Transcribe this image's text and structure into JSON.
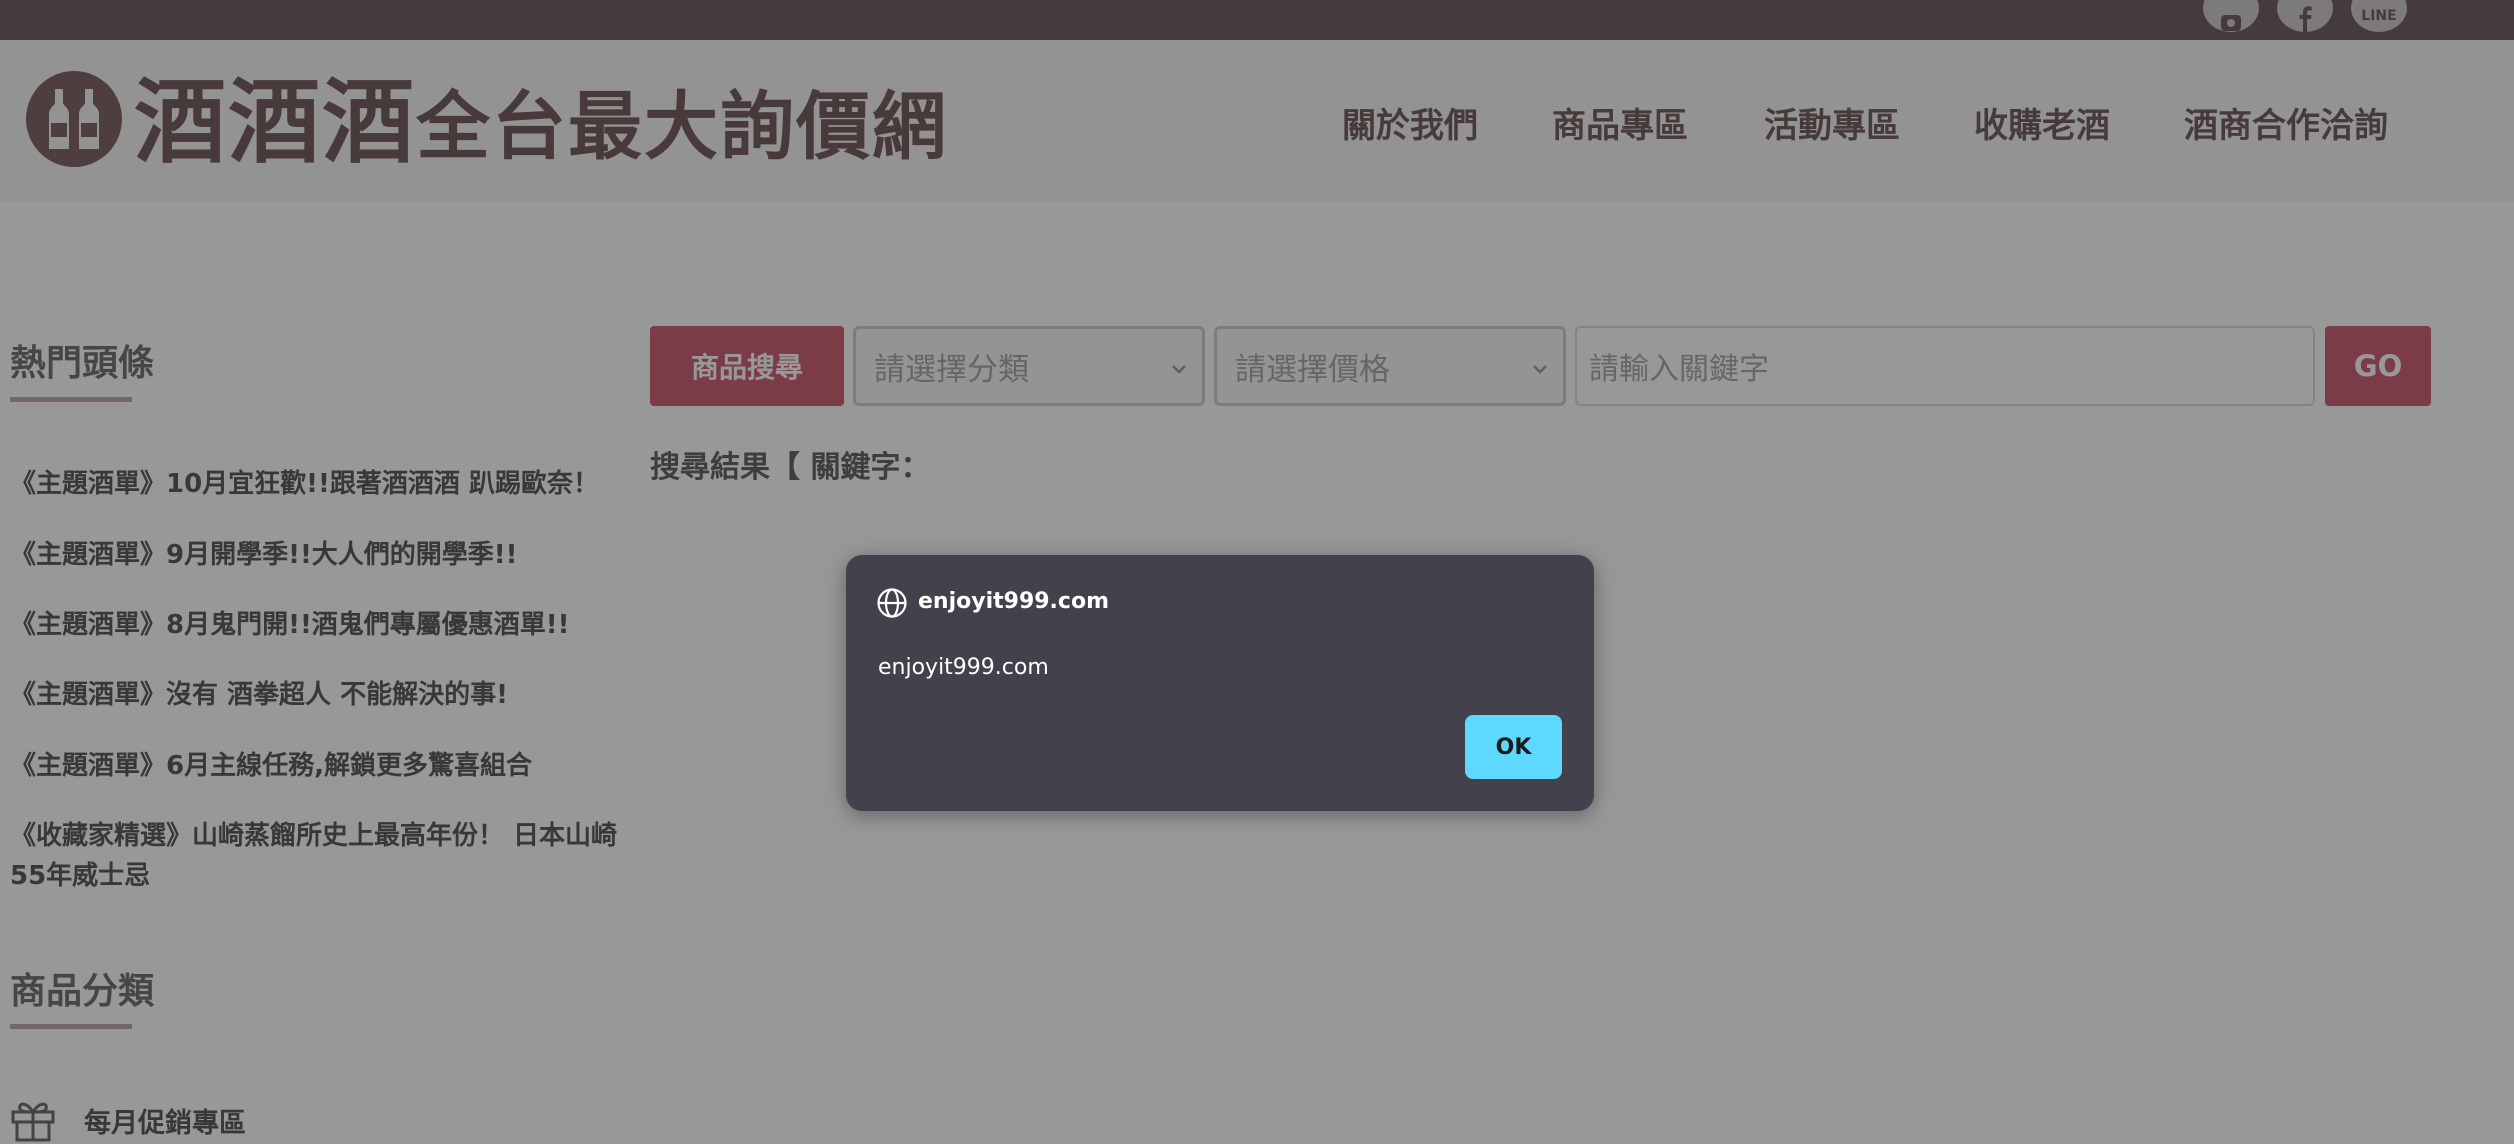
{
  "header": {
    "logo_main": "酒酒酒",
    "logo_sub": "全台最大詢價網",
    "nav": [
      {
        "label": "關於我們"
      },
      {
        "label": "商品專區"
      },
      {
        "label": "活動專區"
      },
      {
        "label": "收購老酒"
      },
      {
        "label": "酒商合作洽詢"
      }
    ],
    "social_icons": [
      "instagram-icon",
      "facebook-icon",
      "line-icon"
    ],
    "line_label": "LINE"
  },
  "sidebar": {
    "news_heading": "熱門頭條",
    "news": [
      "《主題酒單》10月宜狂歡!!跟著酒酒酒 趴踢歐奈！",
      "《主題酒單》9月開學季!!大人們的開學季!!",
      "《主題酒單》8月鬼門開!!酒鬼們專屬優惠酒單!!",
      "《主題酒單》沒有 酒拳超人 不能解決的事!",
      "《主題酒單》6月主線任務,解鎖更多驚喜組合",
      "《收藏家精選》山崎蒸餾所史上最高年份！ 日本山崎55年威士忌"
    ],
    "category_heading": "商品分類",
    "categories": [
      {
        "label": "每月促銷專區",
        "icon": "gift-icon"
      }
    ]
  },
  "search": {
    "button_label": "商品搜尋",
    "category_placeholder": "請選擇分類",
    "price_placeholder": "請選擇價格",
    "keyword_placeholder": "請輸入關鍵字",
    "keyword_value": "",
    "go_label": "GO",
    "result_text": "搜尋結果【 關鍵字："
  },
  "dialog": {
    "title": "enjoyit999.com",
    "message": "enjoyit999.com",
    "ok_label": "OK"
  },
  "colors": {
    "topbar": "#5b4446",
    "brand": "#5e4244",
    "accent": "#c4475c",
    "dialog_bg": "#43414c",
    "ok_button": "#5fd8ff"
  }
}
